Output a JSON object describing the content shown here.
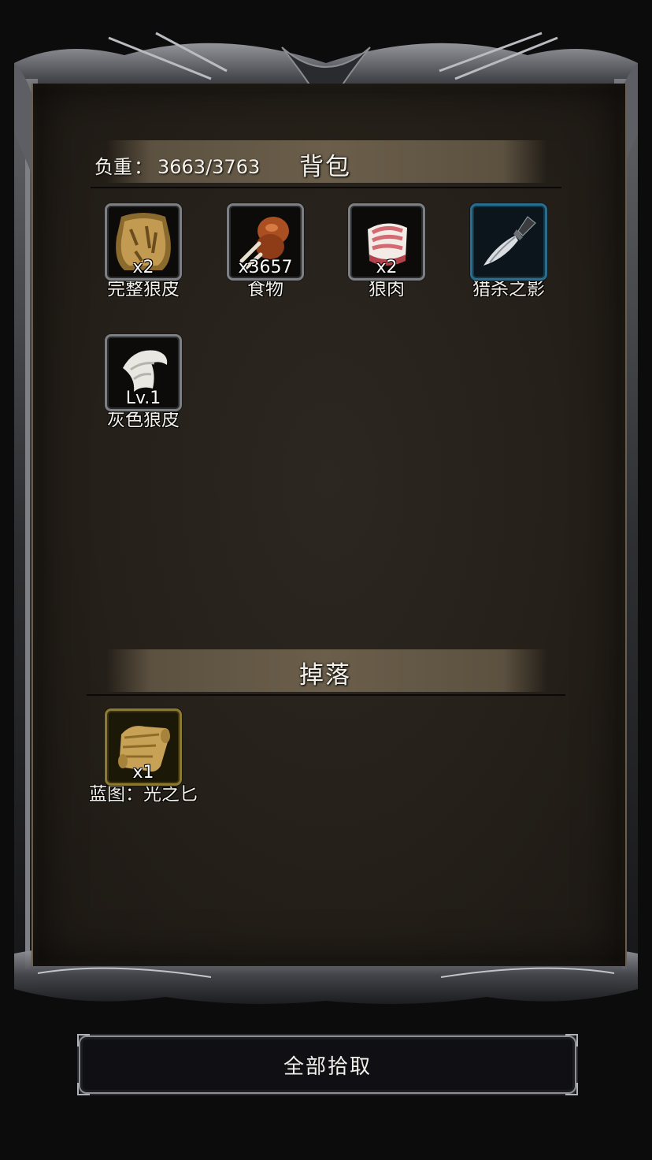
{
  "backpack": {
    "title": "背包",
    "weight_label": "负重",
    "weight_value": "3663/3763",
    "items": [
      {
        "name": "完整狼皮",
        "qty": "x2",
        "icon": "wolf-pelt-icon"
      },
      {
        "name": "食物",
        "qty": "x3657",
        "icon": "drumstick-icon"
      },
      {
        "name": "狼肉",
        "qty": "x2",
        "icon": "raw-meat-icon"
      },
      {
        "name": "猎杀之影",
        "qty": "",
        "icon": "dagger-icon"
      },
      {
        "name": "灰色狼皮",
        "qty": "Lv.1",
        "icon": "gray-fur-icon"
      }
    ]
  },
  "drops": {
    "title": "掉落",
    "items": [
      {
        "name": "蓝图：光之匕",
        "qty": "x1",
        "icon": "scroll-icon"
      }
    ]
  },
  "pickup_all_label": "全部拾取",
  "colors": {
    "background": "#0d0c0c",
    "panel": "#252019",
    "header_band": "#6b5f4b",
    "slot_border": "#7d7f83",
    "rare_border": "#2b6d8c",
    "gold_border": "#8b7a34"
  }
}
